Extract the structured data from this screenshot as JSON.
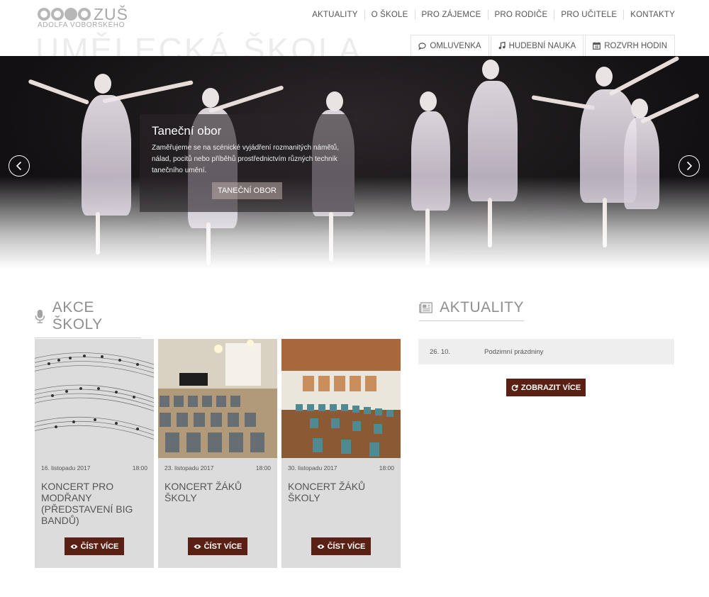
{
  "logo": {
    "name": "ZUŠ",
    "subtitle": "ADOLFA VOBORSKÉHO",
    "bg_title": "UMĚLECKÁ ŠKOLA"
  },
  "nav": {
    "items": [
      {
        "label": "AKTUALITY"
      },
      {
        "label": "O ŠKOLE"
      },
      {
        "label": "PRO ZÁJEMCE"
      },
      {
        "label": "PRO RODIČE"
      },
      {
        "label": "PRO UČITELE"
      },
      {
        "label": "KONTAKTY"
      }
    ]
  },
  "quick_links": [
    {
      "label": "OMLUVENKA",
      "icon": "comment-icon"
    },
    {
      "label": "HUDEBNÍ NAUKA",
      "icon": "music-icon"
    },
    {
      "label": "ROZVRH HODIN",
      "icon": "calendar-icon"
    }
  ],
  "slider": {
    "title": "Taneční obor",
    "text": "Zaměřujeme se na scénické vyjádření rozmanitých námětů, nálad, pocitů nebo příběhů prostřednictvím různých technik tanečního umění.",
    "button": "TANEČNÍ OBOR"
  },
  "akce": {
    "title": "AKCE ŠKOLY",
    "read_more": "ČÍST VÍCE",
    "items": [
      {
        "date": "16. listopadu 2017",
        "time": "18:00",
        "title": "KONCERT PRO MODŘANY (PŘEDSTAVENÍ BIG BANDŮ)"
      },
      {
        "date": "23. listopadu 2017",
        "time": "18:00",
        "title": "KONCERT ŽÁKŮ ŠKOLY"
      },
      {
        "date": "30. listopadu 2017",
        "time": "18:00",
        "title": "KONCERT ŽÁKŮ ŠKOLY"
      }
    ]
  },
  "aktuality": {
    "title": "AKTUALITY",
    "items": [
      {
        "date": "26. 10.",
        "title": "Podzimní prázdniny"
      }
    ],
    "more": "ZOBRAZIT VÍCE"
  },
  "colors": {
    "button": "#5a2014",
    "card_bg": "#dcdcdc",
    "news_bg": "#efeeee"
  }
}
